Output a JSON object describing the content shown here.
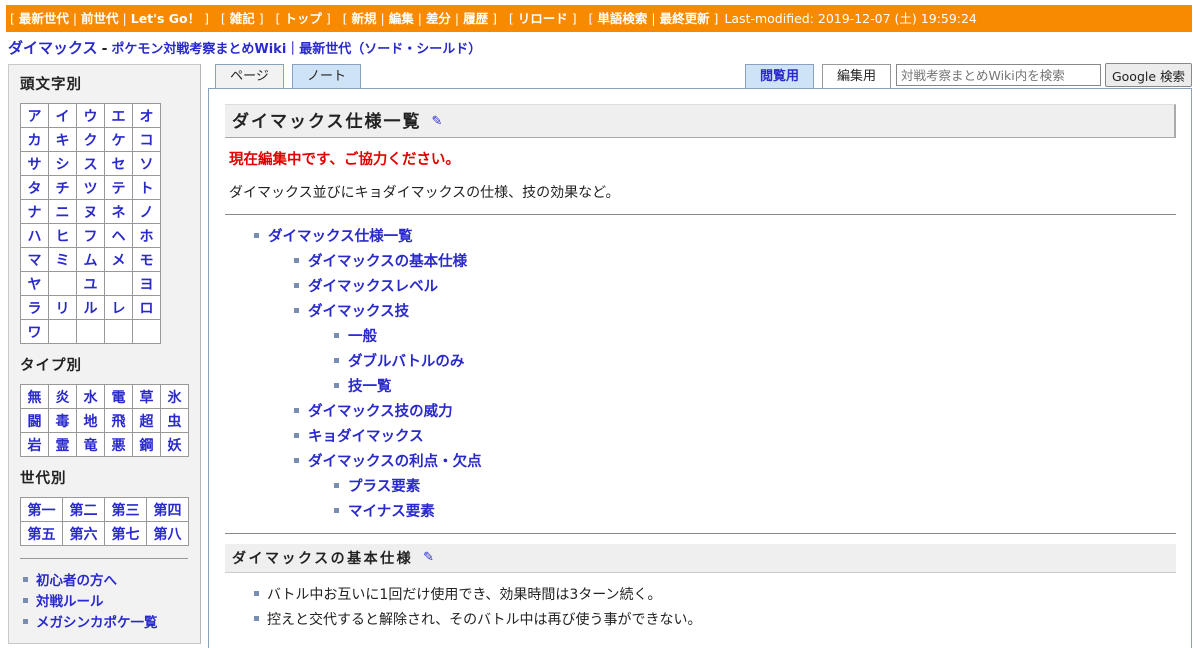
{
  "topnav": {
    "group1": [
      "最新世代",
      "前世代",
      "Let's Go！"
    ],
    "group2": [
      "雑記"
    ],
    "group3": [
      "トップ"
    ],
    "group4": [
      "新規",
      "編集",
      "差分",
      "履歴"
    ],
    "group5": [
      "リロード"
    ],
    "group6": [
      "単語検索",
      "最終更新"
    ],
    "last_modified": "Last-modified: 2019-12-07 (土) 19:59:24"
  },
  "site": {
    "page_name": "ダイマックス",
    "separator": "-",
    "wiki_name": "ポケモン対戦考察まとめWiki｜最新世代（ソード・シールド）"
  },
  "sidebar": {
    "kana_heading": "頭文字別",
    "kana_rows": [
      [
        "ア",
        "イ",
        "ウ",
        "エ",
        "オ"
      ],
      [
        "カ",
        "キ",
        "ク",
        "ケ",
        "コ"
      ],
      [
        "サ",
        "シ",
        "ス",
        "セ",
        "ソ"
      ],
      [
        "タ",
        "チ",
        "ツ",
        "テ",
        "ト"
      ],
      [
        "ナ",
        "ニ",
        "ヌ",
        "ネ",
        "ノ"
      ],
      [
        "ハ",
        "ヒ",
        "フ",
        "ヘ",
        "ホ"
      ],
      [
        "マ",
        "ミ",
        "ム",
        "メ",
        "モ"
      ],
      [
        "ヤ",
        "",
        "ユ",
        "",
        "ヨ"
      ],
      [
        "ラ",
        "リ",
        "ル",
        "レ",
        "ロ"
      ],
      [
        "ワ",
        "",
        "",
        "",
        ""
      ]
    ],
    "type_heading": "タイプ別",
    "type_rows": [
      [
        "無",
        "炎",
        "水",
        "電",
        "草",
        "氷"
      ],
      [
        "闘",
        "毒",
        "地",
        "飛",
        "超",
        "虫"
      ],
      [
        "岩",
        "霊",
        "竜",
        "悪",
        "鋼",
        "妖"
      ]
    ],
    "gen_heading": "世代別",
    "gen_rows": [
      [
        "第一",
        "第二",
        "第三",
        "第四"
      ],
      [
        "第五",
        "第六",
        "第七",
        "第八"
      ]
    ],
    "links": [
      "初心者の方へ",
      "対戦ルール",
      "メガシンカポケ一覧"
    ]
  },
  "tabs": {
    "page": "ページ",
    "note": "ノート",
    "view": "閲覧用",
    "edit": "編集用"
  },
  "search": {
    "placeholder": "対戦考察まとめWiki内を検索",
    "button": "Google 検索"
  },
  "main": {
    "heading": "ダイマックス仕様一覧",
    "notice": "現在編集中です、ご協力ください。",
    "description": "ダイマックス並びにキョダイマックスの仕様、技の効果など。",
    "toc": [
      "ダイマックス仕様一覧",
      "ダイマックスの基本仕様",
      "ダイマックスレベル",
      "ダイマックス技",
      "一般",
      "ダブルバトルのみ",
      "技一覧",
      "ダイマックス技の威力",
      "キョダイマックス",
      "ダイマックスの利点・欠点",
      "プラス要素",
      "マイナス要素"
    ],
    "section_heading": "ダイマックスの基本仕様",
    "bullets": [
      "バトル中お互いに1回だけ使用でき、効果時間は3ターン続く。",
      "控えと交代すると解除され、そのバトル中は再び使う事ができない。"
    ]
  },
  "icons": {
    "edit": "pencil-icon"
  },
  "colors": {
    "topbar": "#f78a00",
    "link": "#2a2acc",
    "notice": "#e00000"
  }
}
